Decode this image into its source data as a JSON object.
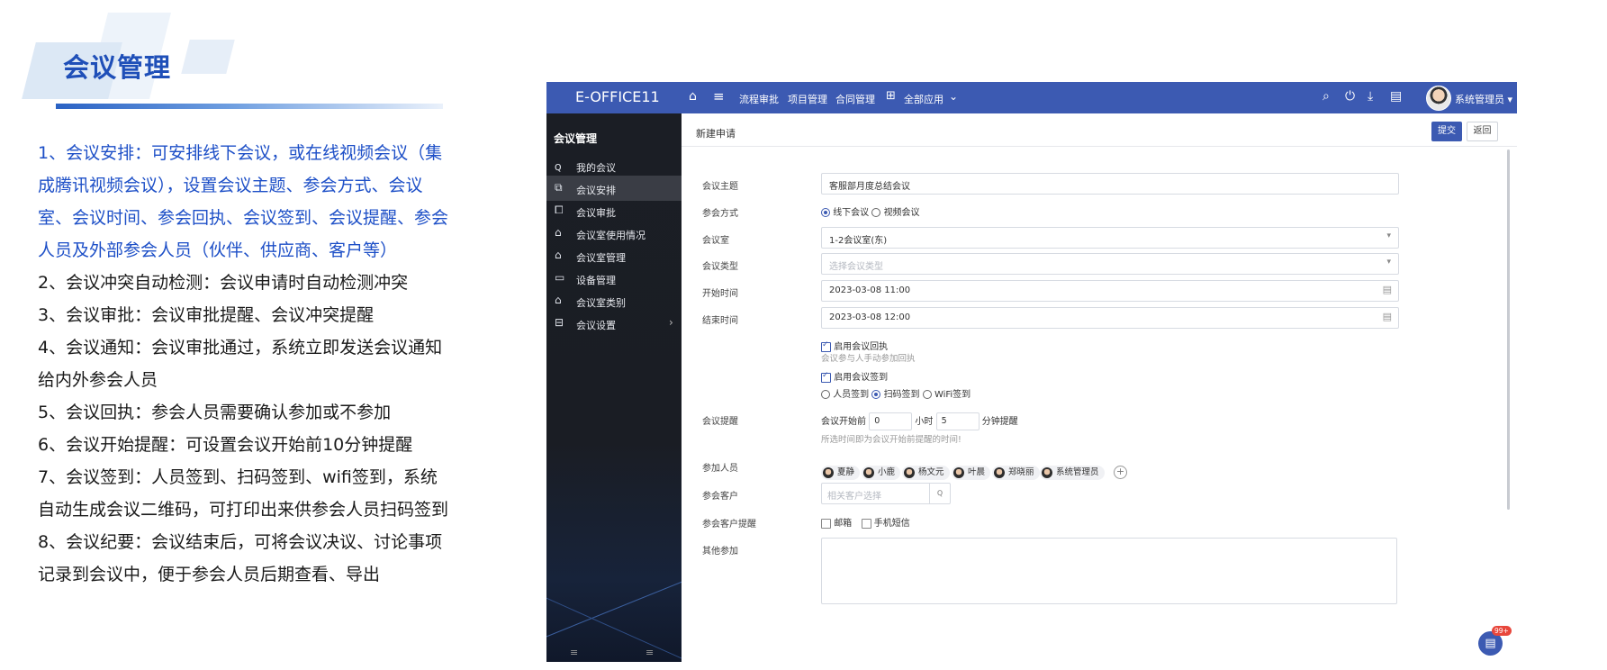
{
  "slide": {
    "title": "会议管理",
    "paragraphs": [
      {
        "text": "1、会议安排：可安排线下会议，或在线视频会议（集成腾讯视频会议），设置会议主题、参会方式、会议室、会议时间、参会回执、会议签到、会议提醒、参会人员及外部参会人员（伙伴、供应商、客户等）",
        "color": "#1d4fc7"
      },
      {
        "text": "2、会议冲突自动检测：会议申请时自动检测冲突",
        "color": "#1a1a1a"
      },
      {
        "text": "3、会议审批：会议审批提醒、会议冲突提醒",
        "color": "#1a1a1a"
      },
      {
        "text": "4、会议通知：会议审批通过，系统立即发送会议通知给内外参会人员",
        "color": "#1a1a1a"
      },
      {
        "text": "5、会议回执：参会人员需要确认参加或不参加",
        "color": "#1a1a1a"
      },
      {
        "text": "6、会议开始提醒：可设置会议开始前10分钟提醒",
        "color": "#1a1a1a"
      },
      {
        "text": "7、会议签到：人员签到、扫码签到、wifi签到，系统自动生成会议二维码，可打印出来供参会人员扫码签到",
        "color": "#1a1a1a"
      },
      {
        "text": "8、会议纪要：会议结束后，可将会议决议、讨论事项记录到会议中，便于参会人员后期查看、导出",
        "color": "#1a1a1a"
      }
    ]
  },
  "app": {
    "brand": "E-OFFICE11",
    "nav": [
      "流程审批",
      "项目管理",
      "合同管理",
      "全部应用"
    ],
    "user": "系统管理员",
    "colors": {
      "primary": "#3c5ab2",
      "sidebar": "#1b1e25"
    },
    "icons": {
      "home": "home-icon",
      "menu": "hamburger-icon",
      "search": "search-icon",
      "power": "power-icon",
      "download": "download-icon",
      "doc": "document-icon"
    }
  },
  "sidebar": {
    "title": "会议管理",
    "items": [
      {
        "label": "我的会议",
        "icon": "user-icon"
      },
      {
        "label": "会议安排",
        "icon": "schedule-icon"
      },
      {
        "label": "会议审批",
        "icon": "approval-icon"
      },
      {
        "label": "会议室使用情况",
        "icon": "room-usage-icon"
      },
      {
        "label": "会议室管理",
        "icon": "room-manage-icon"
      },
      {
        "label": "设备管理",
        "icon": "device-icon"
      },
      {
        "label": "会议室类别",
        "icon": "category-icon"
      },
      {
        "label": "会议设置",
        "icon": "settings-icon"
      }
    ],
    "active_index": 1
  },
  "form": {
    "page_title": "新建申请",
    "submit": "提交",
    "back": "返回",
    "subject": {
      "label": "会议主题",
      "value": "客服部月度总结会议"
    },
    "mode": {
      "label": "参会方式",
      "options": [
        "线下会议",
        "视频会议"
      ],
      "selected": "线下会议"
    },
    "room": {
      "label": "会议室",
      "value": "1-2会议室(东)"
    },
    "type": {
      "label": "会议类型",
      "placeholder": "选择会议类型"
    },
    "start": {
      "label": "开始时间",
      "value": "2023-03-08 11:00"
    },
    "end": {
      "label": "结束时间",
      "value": "2023-03-08 12:00"
    },
    "receipt": {
      "label": "启用会议回执",
      "hint": "会议参与人手动参加回执",
      "checked": true
    },
    "signin": {
      "label": "启用会议签到",
      "checked": true,
      "options": [
        "人员签到",
        "扫码签到",
        "WiFi签到"
      ],
      "selected": "扫码签到"
    },
    "reminder": {
      "label": "会议提醒",
      "prefix": "会议开始前",
      "hours": "0",
      "hours_unit": "小时",
      "minutes": "5",
      "suffix": "分钟提醒",
      "hint": "所选时间即为会议开始前提醒的时间!"
    },
    "attendees": {
      "label": "参加人员",
      "people": [
        "夏静",
        "小鹿",
        "杨文元",
        "叶晨",
        "郑晓丽",
        "系统管理员"
      ]
    },
    "customer": {
      "label": "参会客户",
      "placeholder": "相关客户选择"
    },
    "customer_remind": {
      "label": "参会客户提醒",
      "options": [
        "邮箱",
        "手机短信"
      ]
    },
    "other": {
      "label": "其他参加"
    }
  },
  "chat_badge": "99+"
}
